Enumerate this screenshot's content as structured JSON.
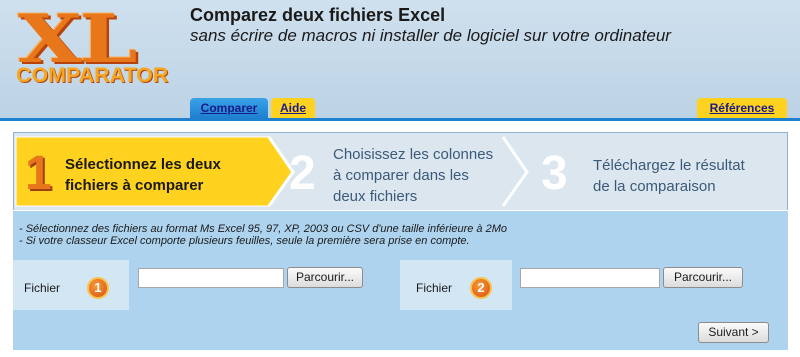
{
  "logo": {
    "big": "XL",
    "small": "COMPARATOR"
  },
  "header": {
    "title": "Comparez deux fichiers Excel",
    "subtitle": "sans écrire de macros ni installer de logiciel sur votre ordinateur"
  },
  "tabs": {
    "compare": "Comparer",
    "aide": "Aide",
    "references": "Références"
  },
  "steps": [
    {
      "number": "1",
      "line1": "Sélectionnez les deux",
      "line2": "fichiers à comparer",
      "line3": ""
    },
    {
      "number": "2",
      "line1": "Choisissez les colonnes",
      "line2": "à comparer dans les",
      "line3": "deux fichiers"
    },
    {
      "number": "3",
      "line1": "Téléchargez le résultat",
      "line2": "de la comparaison",
      "line3": ""
    }
  ],
  "info": {
    "line1": "- Sélectionnez des fichiers au format Ms Excel 95, 97, XP, 2003 ou CSV d'une taille inférieure à 2Mo",
    "line2": "- Si votre classeur Excel comporte plusieurs feuilles, seule la première sera prise en compte."
  },
  "files": [
    {
      "label": "Fichier",
      "badge": "1",
      "value": "",
      "browse": "Parcourir..."
    },
    {
      "label": "Fichier",
      "badge": "2",
      "value": "",
      "browse": "Parcourir..."
    }
  ],
  "next_button": "Suivant >",
  "colors": {
    "accent_blue": "#1f80cf",
    "active_step": "#ffd21f",
    "tab_yellow": "#ffd21f"
  }
}
